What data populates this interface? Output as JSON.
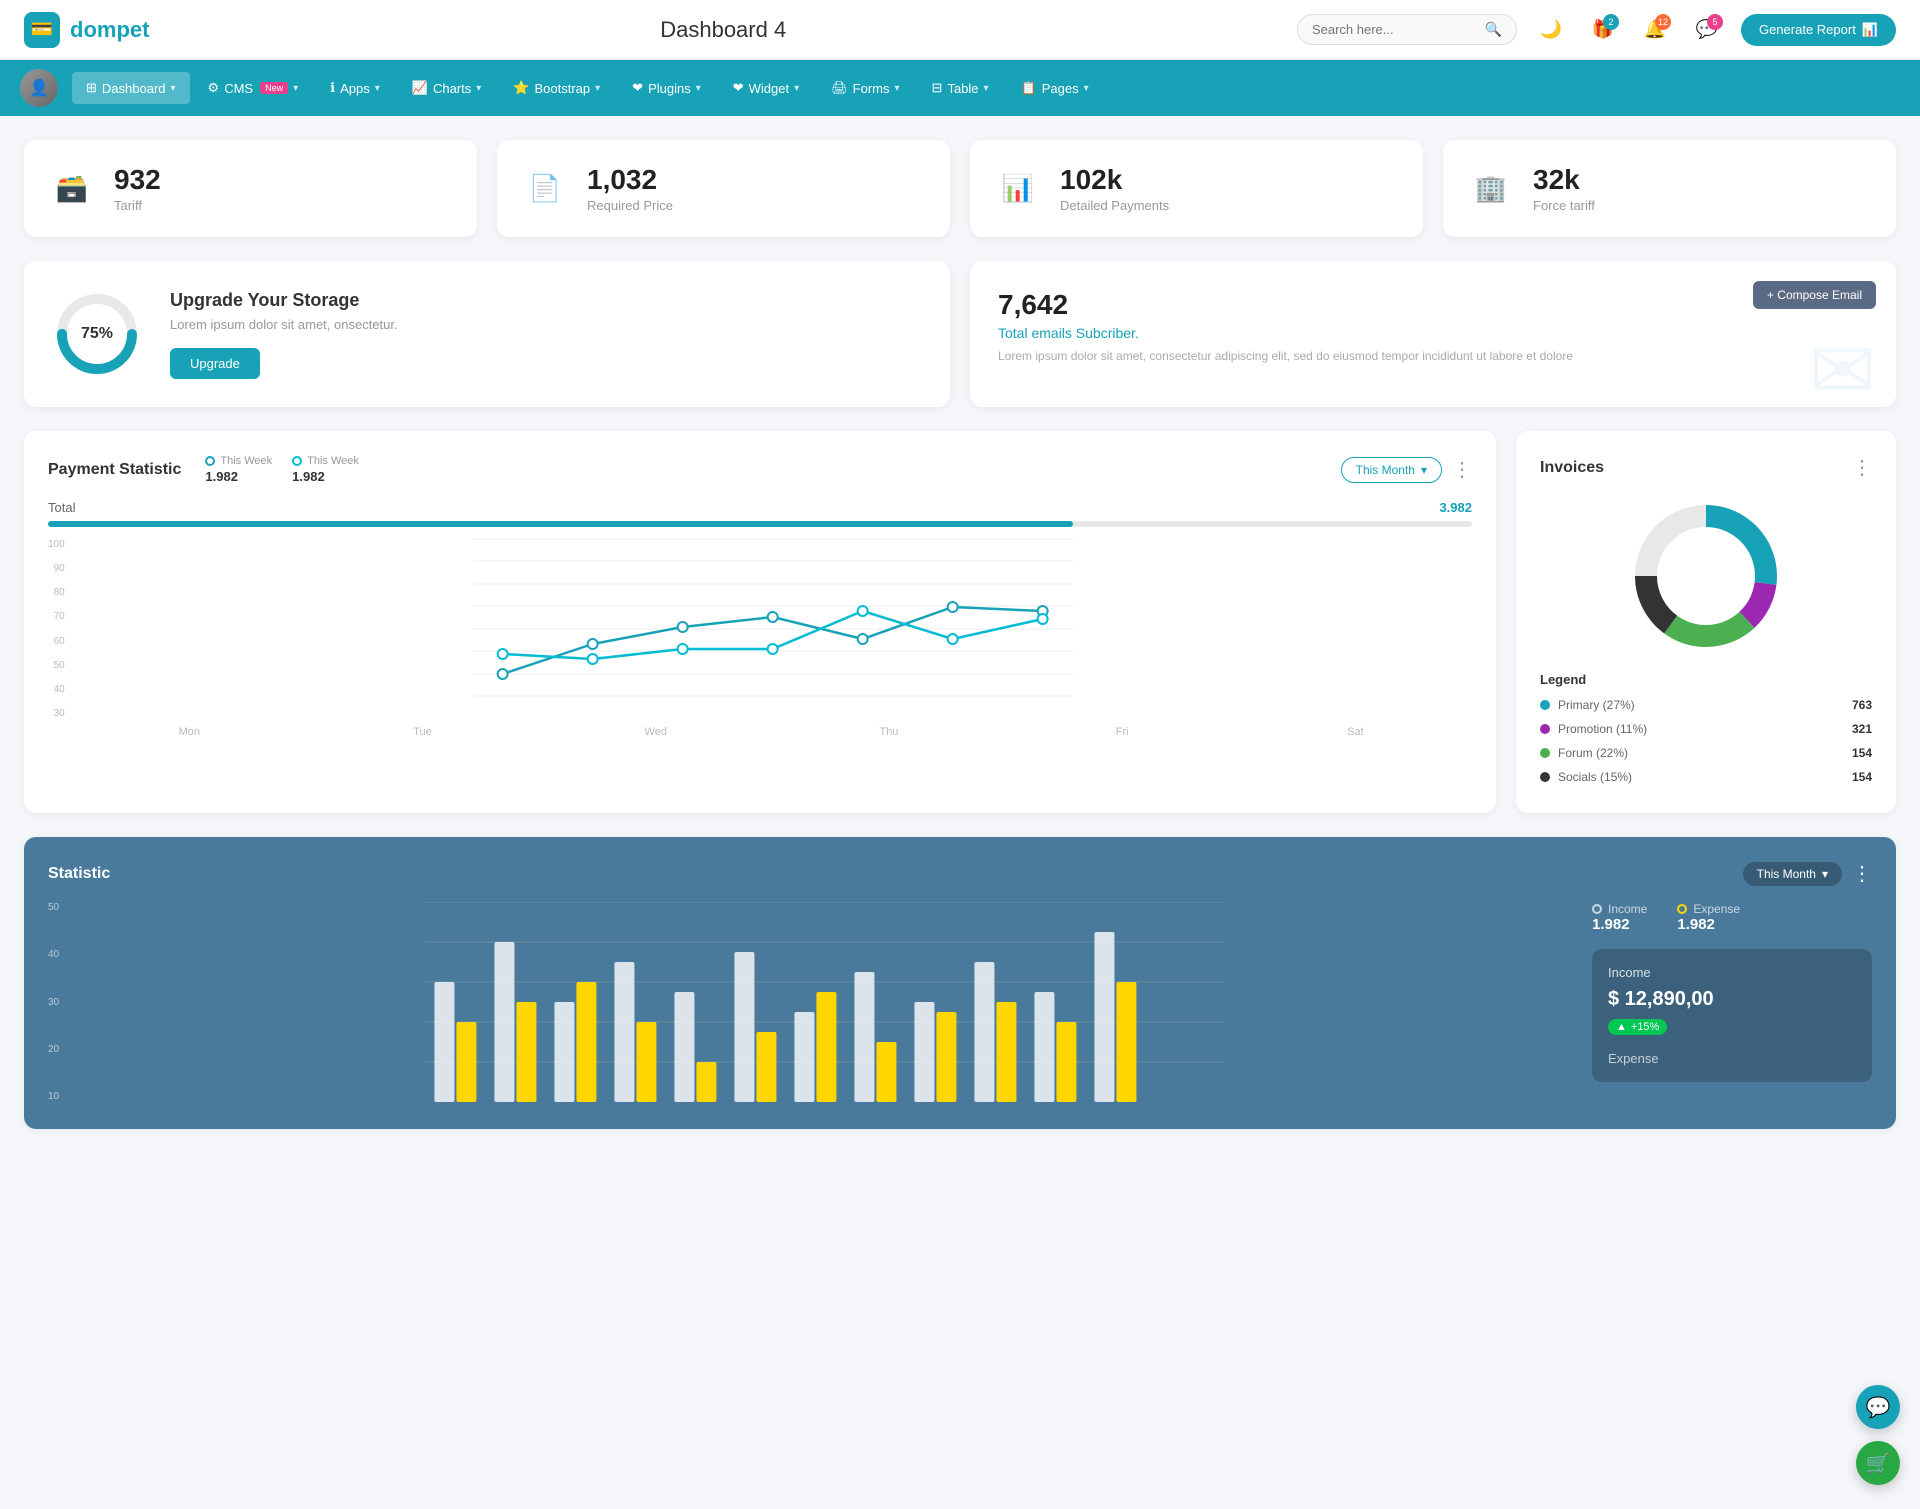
{
  "header": {
    "logo_text": "dompet",
    "page_title": "Dashboard 4",
    "search_placeholder": "Search here...",
    "icons": {
      "theme": "🌙",
      "gift_badge": "2",
      "bell_badge": "12",
      "chat_badge": "5"
    },
    "generate_btn": "Generate Report"
  },
  "nav": {
    "items": [
      {
        "label": "Dashboard",
        "active": true,
        "has_arrow": true
      },
      {
        "label": "CMS",
        "active": false,
        "has_arrow": true,
        "badge": "New"
      },
      {
        "label": "Apps",
        "active": false,
        "has_arrow": true
      },
      {
        "label": "Charts",
        "active": false,
        "has_arrow": true
      },
      {
        "label": "Bootstrap",
        "active": false,
        "has_arrow": true
      },
      {
        "label": "Plugins",
        "active": false,
        "has_arrow": true
      },
      {
        "label": "Widget",
        "active": false,
        "has_arrow": true
      },
      {
        "label": "Forms",
        "active": false,
        "has_arrow": true
      },
      {
        "label": "Table",
        "active": false,
        "has_arrow": true
      },
      {
        "label": "Pages",
        "active": false,
        "has_arrow": true
      }
    ]
  },
  "stat_cards": [
    {
      "icon": "🗃️",
      "icon_color": "#17a2b8",
      "value": "932",
      "label": "Tariff"
    },
    {
      "icon": "📄",
      "icon_color": "#e83e8c",
      "value": "1,032",
      "label": "Required Price"
    },
    {
      "icon": "📊",
      "icon_color": "#6f42c1",
      "value": "102k",
      "label": "Detailed Payments"
    },
    {
      "icon": "🏢",
      "icon_color": "#e83e8c",
      "value": "32k",
      "label": "Force tariff"
    }
  ],
  "storage": {
    "percent": 75,
    "title": "Upgrade Your Storage",
    "desc": "Lorem ipsum dolor sit amet, onsectetur.",
    "btn_label": "Upgrade"
  },
  "email_card": {
    "count": "7,642",
    "sub_label": "Total emails Subcriber.",
    "desc": "Lorem ipsum dolor sit amet, consectetur adipiscing elit, sed do eiusmod tempor incididunt ut labore et dolore",
    "compose_btn": "+ Compose Email"
  },
  "payment_statistic": {
    "title": "Payment Statistic",
    "legend": [
      {
        "label": "This Week",
        "value": "1.982",
        "dot": "teal"
      },
      {
        "label": "This Week",
        "value": "1.982",
        "dot": "cyan"
      }
    ],
    "filter_btn": "This Month",
    "total_label": "Total",
    "total_value": "3.982",
    "progress_pct": 72,
    "x_labels": [
      "Mon",
      "Tue",
      "Wed",
      "Thu",
      "Fri",
      "Sat"
    ],
    "y_labels": [
      "100",
      "90",
      "80",
      "70",
      "60",
      "50",
      "40",
      "30"
    ],
    "line1_points": "40,140 80,120 160,95 240,85 320,110 400,80 480,75 560,80",
    "line2_points": "40,120 80,125 160,115 240,115 320,80 400,105 480,105 560,85"
  },
  "invoices": {
    "title": "Invoices",
    "donut": {
      "segments": [
        {
          "label": "Primary",
          "pct": 27,
          "color": "#17a2b8",
          "value": "763"
        },
        {
          "label": "Promotion",
          "pct": 11,
          "color": "#9c27b0",
          "value": "321"
        },
        {
          "label": "Forum",
          "pct": 22,
          "color": "#4caf50",
          "value": "154"
        },
        {
          "label": "Socials",
          "pct": 15,
          "color": "#333",
          "value": "154"
        }
      ]
    },
    "legend_title": "Legend"
  },
  "statistic": {
    "title": "Statistic",
    "filter_btn": "This Month",
    "income": {
      "label": "Income",
      "value": "1.982"
    },
    "expense": {
      "label": "Expense",
      "value": "1.982"
    },
    "y_labels": [
      "50",
      "40",
      "30",
      "20",
      "10"
    ],
    "income_detail": {
      "label": "Income",
      "amount": "$ 12,890,00",
      "change": "+15%"
    },
    "expense_label": "Expense"
  },
  "support_icon": "💬",
  "cart_icon": "🛒"
}
